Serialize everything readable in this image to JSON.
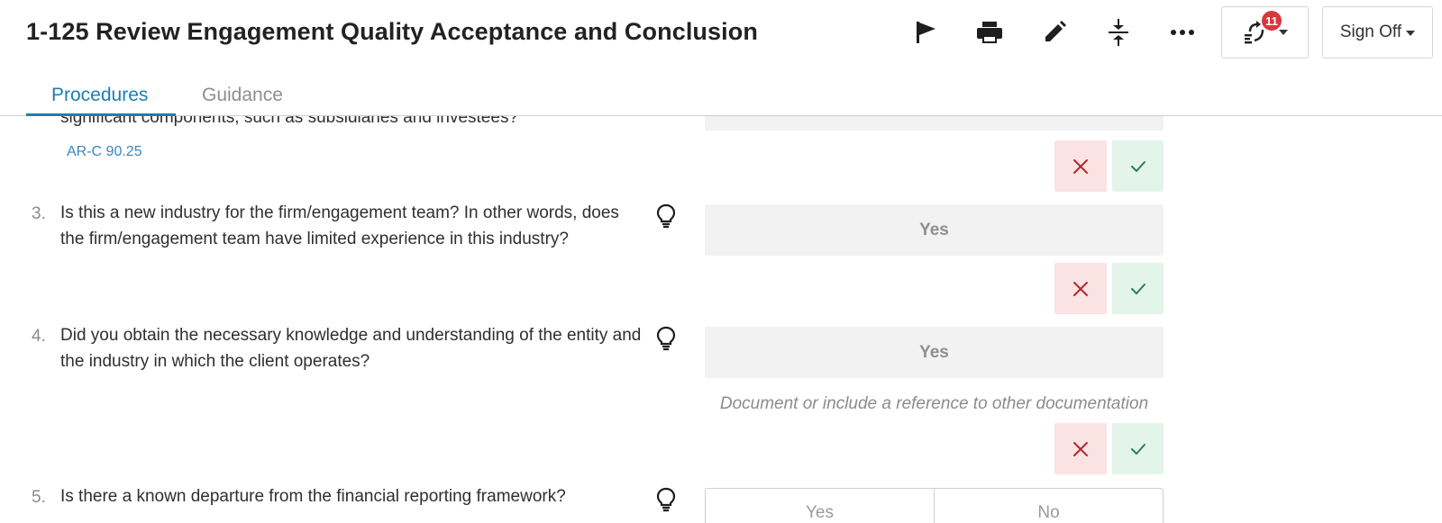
{
  "header": {
    "title": "1-125 Review Engagement Quality Acceptance and Conclusion",
    "toolbar": {
      "flag_icon": "flag-icon",
      "print_icon": "print-icon",
      "edit_icon": "pencil-icon",
      "collapse_icon": "collapse-icon",
      "more_icon": "more-icon",
      "workflow_icon": "workflow-icon",
      "workflow_badge": "11",
      "sign_off_label": "Sign Off"
    }
  },
  "tabs": [
    {
      "label": "Procedures",
      "active": true
    },
    {
      "label": "Guidance",
      "active": false
    }
  ],
  "questions": [
    {
      "number": "",
      "text": "significant components, such as subsidiaries and investees?",
      "reference": "AR-C 90.25"
    },
    {
      "number": "3.",
      "text": "Is this a new industry for the firm/engagement team? In other words, does the firm/engagement team have limited experience in this industry?",
      "answer": "Yes"
    },
    {
      "number": "4.",
      "text": "Did you obtain the necessary knowledge and understanding of the entity and the industry in which the client operates?",
      "answer": "Yes",
      "hint": "Document or include a reference to other documentation"
    },
    {
      "number": "5.",
      "text": "Is there a known departure from the financial reporting framework?",
      "options": [
        "Yes",
        "No"
      ]
    }
  ],
  "colors": {
    "accent": "#1b7fb3",
    "badge": "#d9363e",
    "reject": "#b3282d",
    "accept": "#2e7d4f"
  }
}
